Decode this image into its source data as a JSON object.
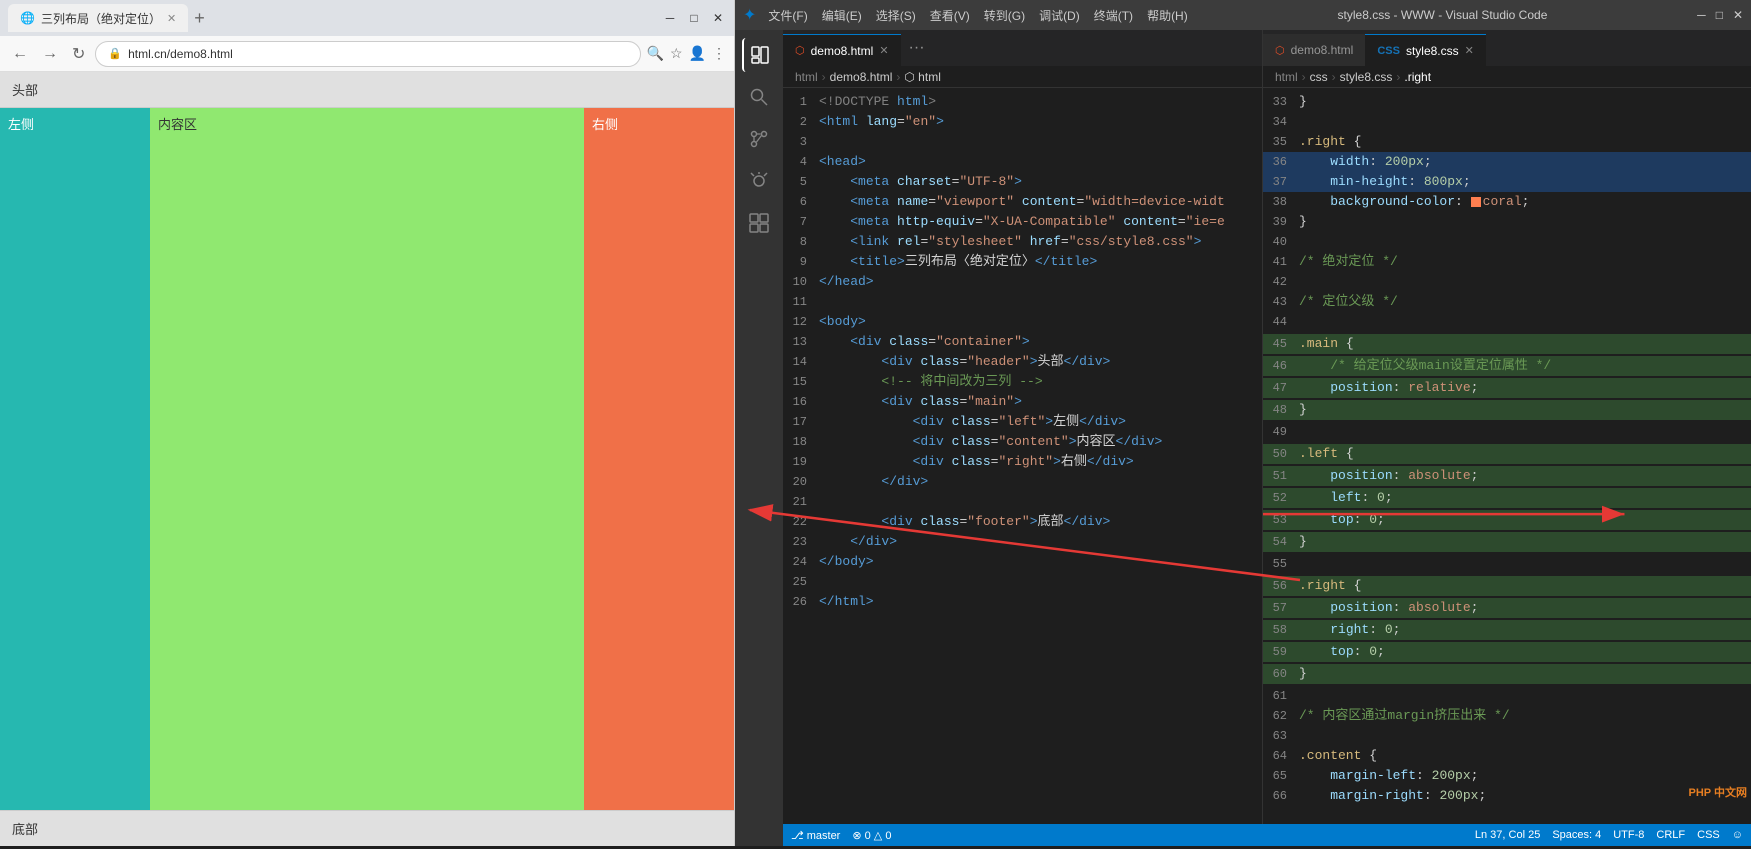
{
  "browser": {
    "tab_title": "三列布局（绝对定位）",
    "url": "html.cn/demo8.html",
    "page": {
      "header_text": "头部",
      "left_text": "左侧",
      "center_text": "内容区",
      "right_text": "右侧",
      "footer_text": "底部"
    }
  },
  "vscode": {
    "title": "style8.css - WWW - Visual Studio Code",
    "menus": [
      "文件(F)",
      "编辑(E)",
      "选择(S)",
      "查看(V)",
      "转到(G)",
      "调试(D)",
      "终端(T)",
      "帮助(H)"
    ],
    "tabs_left": [
      {
        "name": "demo8.html",
        "type": "html",
        "active": false
      },
      {
        "name": "style8.css",
        "type": "css",
        "active": true
      }
    ],
    "breadcrumb_left": [
      "html",
      ">",
      "demo8.html",
      ">",
      "html"
    ],
    "breadcrumb_right": [
      "html",
      ">",
      "css",
      ">",
      "style8.css",
      ">",
      ".right"
    ],
    "html_code": [
      {
        "num": "",
        "text": "<!DOCTYPE html>"
      },
      {
        "num": "",
        "text": "<html lang=\"en\">"
      },
      {
        "num": "",
        "text": ""
      },
      {
        "num": "",
        "text": "<head>"
      },
      {
        "num": "",
        "text": "    <meta charset=\"UTF-8\">"
      },
      {
        "num": "",
        "text": "    <meta name=\"viewport\" content=\"width=device-widt"
      },
      {
        "num": "",
        "text": "    <meta http-equiv=\"X-UA-Compatible\" content=\"ie=e"
      },
      {
        "num": "",
        "text": "    <link rel=\"stylesheet\" href=\"css/style8.css\">"
      },
      {
        "num": "",
        "text": "    <title>三列布局〈绝对定位〉</title>"
      },
      {
        "num": "",
        "text": "</head>"
      },
      {
        "num": "",
        "text": ""
      },
      {
        "num": "",
        "text": "<body>"
      },
      {
        "num": "",
        "text": "    <div class=\"container\">"
      },
      {
        "num": "",
        "text": "        <div class=\"header\">头部</div>"
      },
      {
        "num": "",
        "text": "        <!-- 将中间改为三列 -->"
      },
      {
        "num": "",
        "text": "        <div class=\"main\">"
      },
      {
        "num": "",
        "text": "            <div class=\"left\">左侧</div>"
      },
      {
        "num": "",
        "text": "            <div class=\"content\">内容区</div>"
      },
      {
        "num": "",
        "text": "            <div class=\"right\">右侧</div>"
      },
      {
        "num": "",
        "text": "        </div>"
      },
      {
        "num": "",
        "text": ""
      },
      {
        "num": "",
        "text": "        <div class=\"footer\">底部</div>"
      },
      {
        "num": "",
        "text": "    </div>"
      },
      {
        "num": "",
        "text": "</body>"
      },
      {
        "num": "",
        "text": ""
      },
      {
        "num": "",
        "text": "</html>"
      }
    ],
    "css_blocks": [
      {
        "line": "}",
        "indent": 0
      },
      {
        "line": "",
        "indent": 0
      },
      {
        "line": ".right {",
        "indent": 0,
        "selector": true
      },
      {
        "line": "    width: 200px;",
        "indent": 1
      },
      {
        "line": "    min-height: 800px;",
        "indent": 1
      },
      {
        "line": "    background-color: ■ coral;",
        "indent": 1
      },
      {
        "line": "}",
        "indent": 0
      },
      {
        "line": "",
        "indent": 0
      },
      {
        "line": "/* 绝对定位 */",
        "indent": 0,
        "comment": true
      },
      {
        "line": "",
        "indent": 0
      },
      {
        "line": "/* 定位父级 */",
        "indent": 0,
        "comment": true
      },
      {
        "line": "",
        "indent": 0
      },
      {
        "line": ".main {",
        "indent": 0,
        "selector": true,
        "green": true
      },
      {
        "line": "    /* 给定位父级main设置定位属性 */",
        "indent": 1,
        "comment": true,
        "green": true
      },
      {
        "line": "    position: relative;",
        "indent": 1,
        "green": true
      },
      {
        "line": "}",
        "indent": 0,
        "green": true
      },
      {
        "line": "",
        "indent": 0
      },
      {
        "line": ".left {",
        "indent": 0,
        "selector": true,
        "green": true
      },
      {
        "line": "    position: absolute;",
        "indent": 1,
        "green": true
      },
      {
        "line": "    left: 0;",
        "indent": 1,
        "green": true
      },
      {
        "line": "    top: 0;",
        "indent": 1,
        "green": true
      },
      {
        "line": "}",
        "indent": 0,
        "green": true
      },
      {
        "line": "",
        "indent": 0
      },
      {
        "line": ".right {",
        "indent": 0,
        "selector": true,
        "green": true
      },
      {
        "line": "    position: absolute;",
        "indent": 1,
        "green": true
      },
      {
        "line": "    right: 0;",
        "indent": 1,
        "green": true
      },
      {
        "line": "    top: 0;",
        "indent": 1,
        "green": true
      },
      {
        "line": "}",
        "indent": 0,
        "green": true
      },
      {
        "line": "",
        "indent": 0
      },
      {
        "line": "/* 内容区通过margin挤压出来 */",
        "indent": 0,
        "comment": true
      },
      {
        "line": "",
        "indent": 0
      },
      {
        "line": ".content {",
        "indent": 0,
        "selector": true
      },
      {
        "line": "    margin-left: 200px;",
        "indent": 1
      },
      {
        "line": "    margin-right: 200px;",
        "indent": 1
      }
    ]
  }
}
